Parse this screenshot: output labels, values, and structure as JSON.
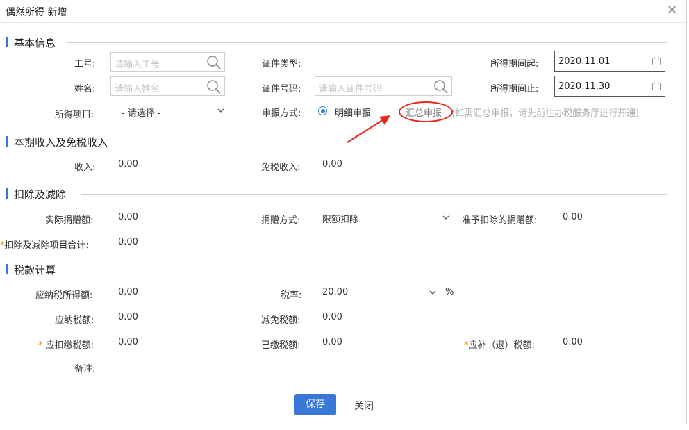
{
  "dialog": {
    "title": "偶然所得 新增",
    "close_glyph": "✕"
  },
  "sections": {
    "basic": "基本信息",
    "income": "本期收入及免税收入",
    "deduct": "扣除及减除",
    "tax": "税款计算"
  },
  "basic": {
    "emp_no_label": "工号:",
    "emp_no_placeholder": "请输入工号",
    "name_label": "姓名:",
    "name_placeholder": "请输入姓名",
    "income_item_label": "所得项目:",
    "income_item_value": "- 请选择 -",
    "id_type_label": "证件类型:",
    "id_no_label": "证件号码:",
    "id_no_placeholder": "请输入证件号码",
    "report_mode_label": "申报方式:",
    "report_detail": "明细申报",
    "report_summary": "汇总申报",
    "report_hint": "(如需汇总申报，请先前往办税服务厅进行开通)",
    "period_start_label": "所得期间起:",
    "period_start_value": "2020.11.01",
    "period_end_label": "所得期间止:",
    "period_end_value": "2020.11.30"
  },
  "income": {
    "income_label": "收入:",
    "income_value": "0.00",
    "exempt_label": "免税收入:",
    "exempt_value": "0.00"
  },
  "deduct": {
    "donation_label": "实际捐赠额:",
    "donation_value": "0.00",
    "donation_method_label": "捐赠方式:",
    "donation_method_value": "限额扣除",
    "allowed_label": "准予扣除的捐赠额:",
    "allowed_value": "0.00",
    "total_label": "扣除及减除项目合计:",
    "total_value": "0.00"
  },
  "tax": {
    "taxable_label": "应纳税所得额:",
    "taxable_value": "0.00",
    "rate_label": "税率:",
    "rate_value": "20.00",
    "rate_unit": "%",
    "tax_due_label": "应纳税额:",
    "tax_due_value": "0.00",
    "relief_label": "减免税额:",
    "relief_value": "0.00",
    "withhold_label": "应扣缴税额:",
    "withhold_value": "0.00",
    "paid_label": "已缴税额:",
    "paid_value": "0.00",
    "refund_label": "应补（退）税额:",
    "refund_value": "0.00",
    "remark_label": "备注:",
    "required_mark": "*"
  },
  "footer": {
    "save": "保存",
    "close": "关闭"
  },
  "colors": {
    "accent": "#3a78d8",
    "required": "#f29100",
    "annotation": "#e8281e"
  }
}
